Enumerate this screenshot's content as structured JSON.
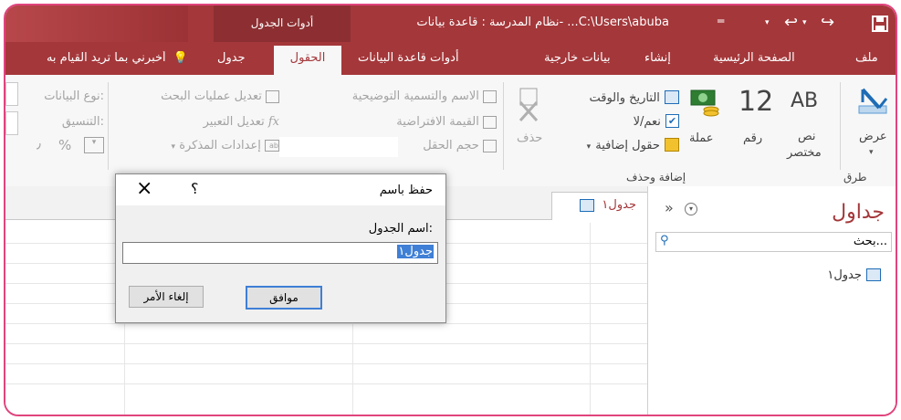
{
  "titlebar": {
    "save_icon": "save-icon",
    "undo_icon": "undo-icon",
    "redo_icon": "redo-icon",
    "title": "نظام المدرسة : قاعدة بيانات- ...C:\\Users\\abuba",
    "context_tab": "أدوات الجدول"
  },
  "tabs": {
    "file": "ملف",
    "home": "الصفحة الرئيسية",
    "create": "إنشاء",
    "external": "بيانات خارجية",
    "dbtools": "أدوات قاعدة البيانات",
    "fields": "الحقول",
    "table": "جدول",
    "tellme": "أخبرني بما تريد القيام به"
  },
  "ribbon": {
    "view_label": "عرض",
    "view_group": "طرق عرض",
    "short_text_glyph": "AB",
    "short_text_label1": "نص",
    "short_text_label2": "مختصر",
    "number_glyph": "12",
    "number_label": "رقم",
    "currency_label": "عملة",
    "datetime_label": "التاريخ والوقت",
    "yesno_label": "نعم/لا",
    "more_fields_label": "حقول إضافية",
    "delete_label": "حذف",
    "add_delete_group": "إضافة وحذف",
    "name_caption": "الاسم والتسمية التوضيحية",
    "default_value": "القيمة الافتراضية",
    "field_size": "حجم الحقل",
    "modify_lookups": "تعديل عمليات البحث",
    "modify_expression": "تعديل التعبير",
    "memo_settings": "إعدادات المذكرة",
    "data_type_label": "نوع البيانات:",
    "format_label": "التنسيق:",
    "percent_glyph": "%",
    "comma_glyph": "٫"
  },
  "document": {
    "tab_label": "جدول١"
  },
  "navpane": {
    "title": "جداول",
    "search_placeholder": "بحث...",
    "item_label": "جدول١"
  },
  "dialog": {
    "title": "حفظ باسم",
    "help_glyph": "؟",
    "close_glyph": "×",
    "field_label": "اسم الجدول:",
    "field_value": "جدول١",
    "ok_label": "موافق",
    "cancel_label": "إلغاء الأمر"
  },
  "colors": {
    "access_red": "#a4373a",
    "border_pink": "#e0447d"
  }
}
